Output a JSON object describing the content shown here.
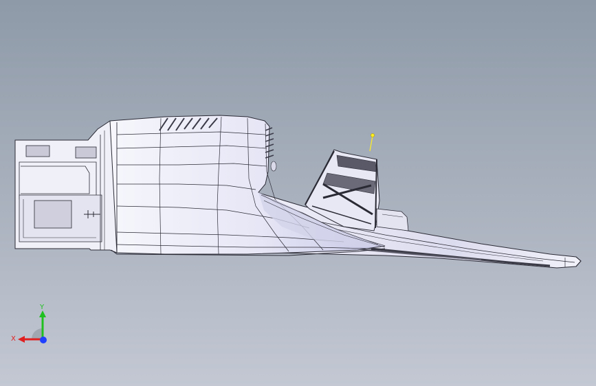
{
  "viewport": {
    "background_top": "#8e9aa8",
    "background_bottom": "#c3c8d3"
  },
  "model": {
    "render_mode": "shaded-with-edges",
    "face_color": "#eeeef8",
    "shade_color": "#c8c8e6",
    "edge_color": "#2a2a35",
    "dark_underside_color": "#3c3c48"
  },
  "sketch_point": {
    "color": "#ffee22"
  },
  "triad": {
    "x_label": "X",
    "y_label": "Y",
    "x_color": "#e02020",
    "y_color": "#20c020",
    "z_color": "#2040ff"
  }
}
